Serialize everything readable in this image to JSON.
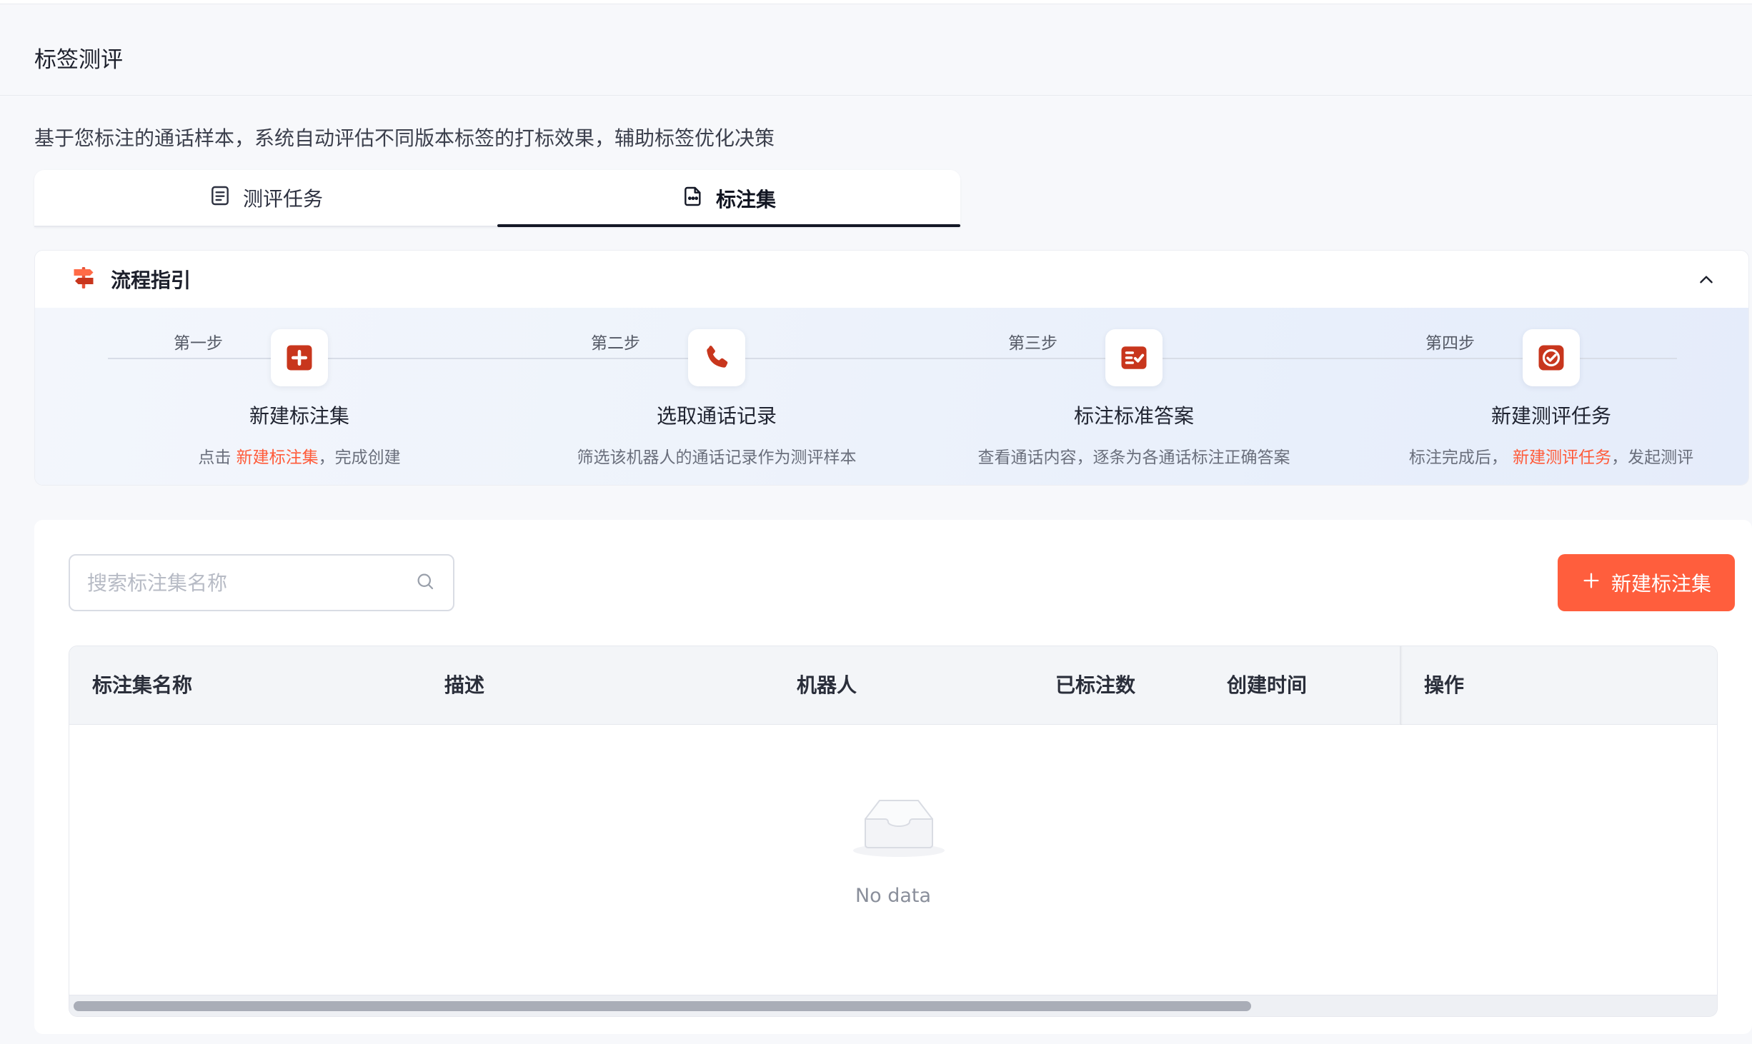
{
  "page": {
    "title": "标签测评",
    "description": "基于您标注的通话样本，系统自动评估不同版本标签的打标效果，辅助标签优化决策"
  },
  "tabs": [
    {
      "label": "测评任务",
      "icon": "document-list-icon",
      "active": false
    },
    {
      "label": "标注集",
      "icon": "file-dots-icon",
      "active": true
    }
  ],
  "guide": {
    "title": "流程指引",
    "icon": "signpost-icon",
    "collapse_icon": "chevron-up-icon",
    "accent_color": "#c8361d",
    "steps": [
      {
        "label": "第一步",
        "title": "新建标注集",
        "icon": "plus-square-icon",
        "desc_prefix": "点击 ",
        "desc_highlight": "新建标注集",
        "desc_suffix": "，完成创建"
      },
      {
        "label": "第二步",
        "title": "选取通话记录",
        "icon": "phone-icon",
        "desc_prefix": "筛选该机器人的通话记录作为测评样本",
        "desc_highlight": "",
        "desc_suffix": ""
      },
      {
        "label": "第三步",
        "title": "标注标准答案",
        "icon": "checklist-icon",
        "desc_prefix": "查看通话内容，逐条为各通话标注正确答案",
        "desc_highlight": "",
        "desc_suffix": ""
      },
      {
        "label": "第四步",
        "title": "新建测评任务",
        "icon": "check-circle-icon",
        "desc_prefix": "标注完成后， ",
        "desc_highlight": "新建测评任务",
        "desc_suffix": "，发起测评"
      }
    ]
  },
  "toolbar": {
    "search_placeholder": "搜索标注集名称",
    "new_button_label": "新建标注集",
    "button_color": "#ff5e3d"
  },
  "table": {
    "columns": [
      "标注集名称",
      "描述",
      "机器人",
      "已标注数",
      "创建时间",
      "操作"
    ],
    "rows": [],
    "empty_text": "No data"
  }
}
